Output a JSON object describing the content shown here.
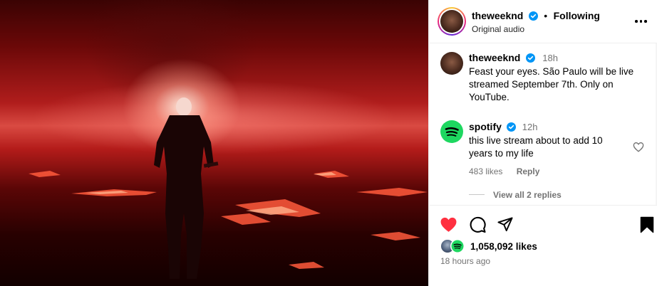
{
  "post": {
    "author": "theweeknd",
    "separator": "•",
    "follow_status": "Following",
    "audio": "Original audio"
  },
  "caption": {
    "author": "theweeknd",
    "time": "18h",
    "text": "Feast your eyes. São Paulo will be live streamed September 7th. Only on YouTube."
  },
  "comments": [
    {
      "author": "spotify",
      "time": "12h",
      "text": "this live stream about to add 10 years to my life",
      "likes": "483 likes",
      "reply_label": "Reply",
      "view_replies": "View all 2 replies"
    }
  ],
  "engagement": {
    "likes": "1,058,092 likes",
    "posted_ago": "18 hours ago",
    "liked": true
  },
  "colors": {
    "heart": "#ff3040",
    "verified": "#0095f6",
    "spotify": "#1ed760"
  },
  "icons": [
    "verified-badge-icon",
    "more-options-icon",
    "heart-icon",
    "comment-icon",
    "share-icon",
    "bookmark-icon",
    "spotify-logo-icon"
  ]
}
